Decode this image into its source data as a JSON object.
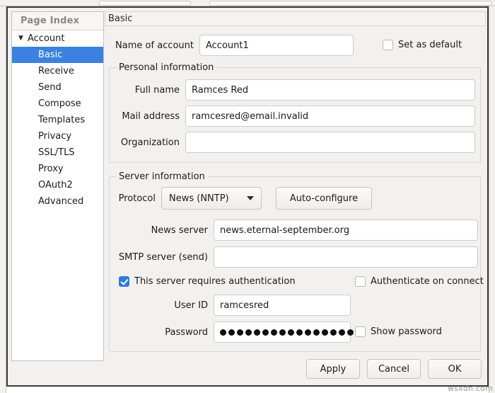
{
  "sidebar": {
    "header": "Page Index",
    "group_label": "Account",
    "items": [
      {
        "label": "Basic",
        "selected": true
      },
      {
        "label": "Receive",
        "selected": false
      },
      {
        "label": "Send",
        "selected": false
      },
      {
        "label": "Compose",
        "selected": false
      },
      {
        "label": "Templates",
        "selected": false
      },
      {
        "label": "Privacy",
        "selected": false
      },
      {
        "label": "SSL/TLS",
        "selected": false
      },
      {
        "label": "Proxy",
        "selected": false
      },
      {
        "label": "OAuth2",
        "selected": false
      },
      {
        "label": "Advanced",
        "selected": false
      }
    ]
  },
  "page": {
    "title": "Basic",
    "account_name_label": "Name of account",
    "account_name_value": "Account1",
    "set_default_label": "Set as default",
    "set_default_checked": false
  },
  "personal": {
    "legend": "Personal information",
    "full_name_label": "Full name",
    "full_name_value": "Ramces Red",
    "mail_address_label": "Mail address",
    "mail_address_value": "ramcesred@email.invalid",
    "organization_label": "Organization",
    "organization_value": ""
  },
  "server": {
    "legend": "Server information",
    "protocol_label": "Protocol",
    "protocol_value": "News (NNTP)",
    "auto_configure_label": "Auto-configure",
    "news_server_label": "News server",
    "news_server_value": "news.eternal-september.org",
    "smtp_server_label": "SMTP server (send)",
    "smtp_server_value": "",
    "requires_auth_label": "This server requires authentication",
    "requires_auth_checked": true,
    "auth_on_connect_label": "Authenticate on connect",
    "auth_on_connect_checked": false,
    "user_id_label": "User ID",
    "user_id_value": "ramcesred",
    "password_label": "Password",
    "password_dots": 16,
    "show_password_label": "Show password",
    "show_password_checked": false
  },
  "buttons": {
    "apply": "Apply",
    "cancel": "Cancel",
    "ok": "OK"
  },
  "watermark": "wsxdn.com",
  "colors": {
    "selection_blue": "#3b82e0",
    "checkbox_blue": "#2f7ce0",
    "window_bg": "#f2f1f0",
    "field_bg": "#ffffff"
  }
}
